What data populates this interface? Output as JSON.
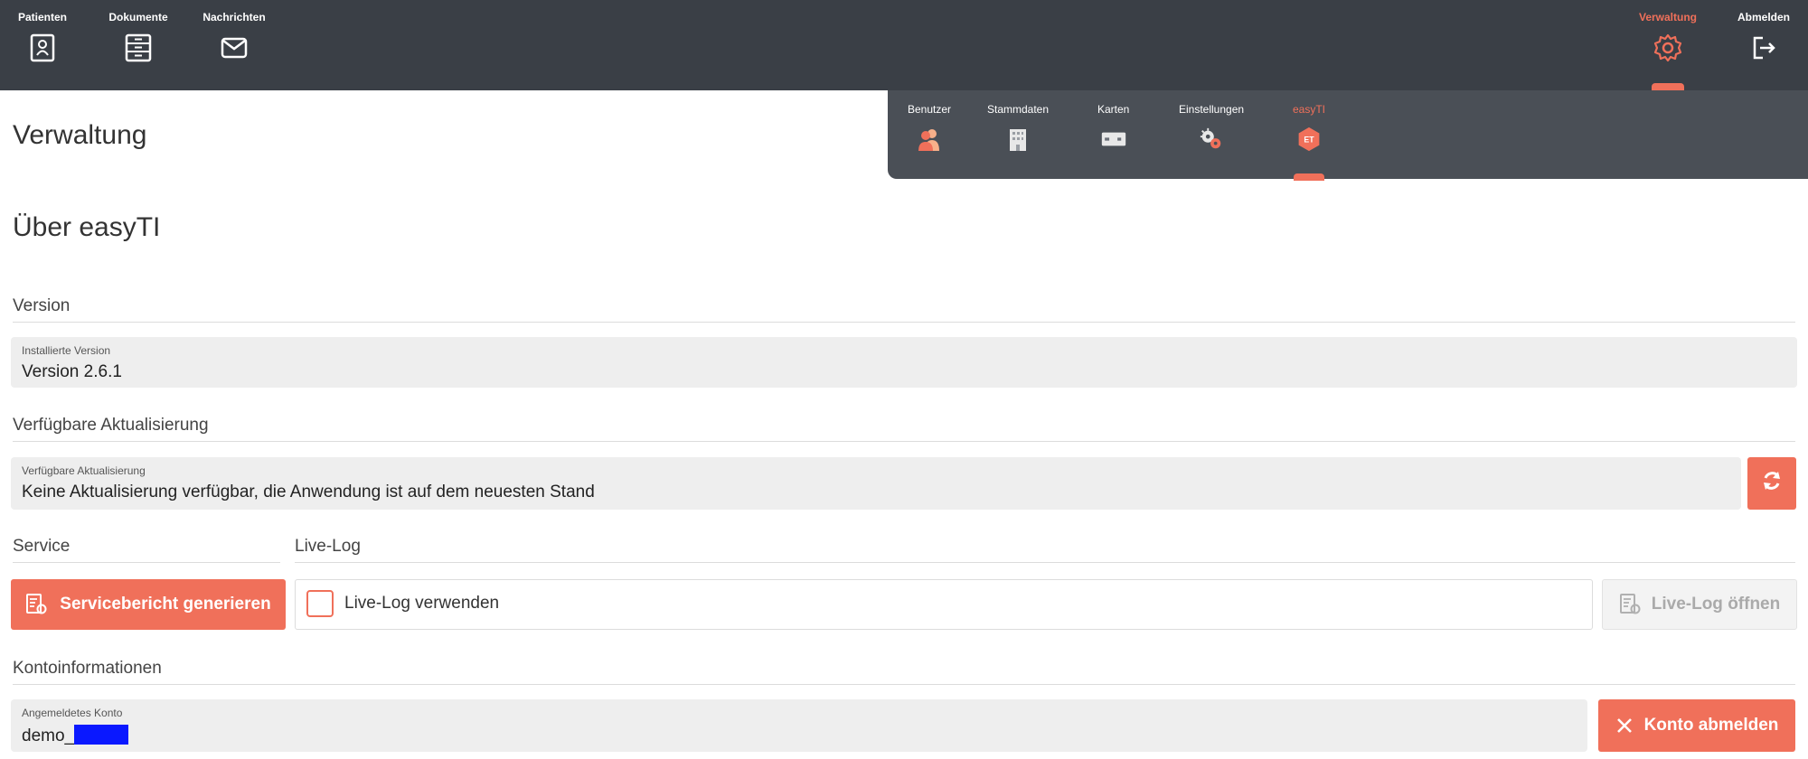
{
  "topnav": {
    "left": [
      {
        "label": "Patienten",
        "icon": "patient-card-icon"
      },
      {
        "label": "Dokumente",
        "icon": "document-cabinet-icon"
      },
      {
        "label": "Nachrichten",
        "icon": "envelope-icon"
      }
    ],
    "right": [
      {
        "label": "Verwaltung",
        "icon": "gear-icon",
        "active": true
      },
      {
        "label": "Abmelden",
        "icon": "logout-icon"
      }
    ]
  },
  "subnav": [
    {
      "label": "Benutzer",
      "icon": "users-icon"
    },
    {
      "label": "Stammdaten",
      "icon": "building-icon"
    },
    {
      "label": "Karten",
      "icon": "card-icon"
    },
    {
      "label": "Einstellungen",
      "icon": "settings-gears-icon"
    },
    {
      "label": "easyTI",
      "icon": "easyti-logo-icon",
      "active": true,
      "badge": "ET"
    }
  ],
  "page": {
    "title": "Verwaltung",
    "section_title": "Über easyTI"
  },
  "version": {
    "header": "Version",
    "field_label": "Installierte Version",
    "field_value": "Version 2.6.1"
  },
  "update": {
    "header": "Verfügbare Aktualisierung",
    "field_label": "Verfügbare Aktualisierung",
    "field_value": "Keine Aktualisierung verfügbar, die Anwendung ist auf dem neuesten Stand",
    "refresh_icon": "refresh-icon"
  },
  "service": {
    "header": "Service",
    "button_label": "Servicebericht generieren"
  },
  "livelog": {
    "header": "Live-Log",
    "checkbox_label": "Live-Log verwenden",
    "checked": false,
    "open_button_label": "Live-Log öffnen"
  },
  "account": {
    "header": "Kontoinformationen",
    "field_label": "Angemeldetes Konto",
    "field_value": "demo_",
    "logout_button_label": "Konto abmelden"
  },
  "colors": {
    "accent": "#f0705a",
    "topbar": "#3a3f46",
    "subbar": "#4a4f56"
  }
}
